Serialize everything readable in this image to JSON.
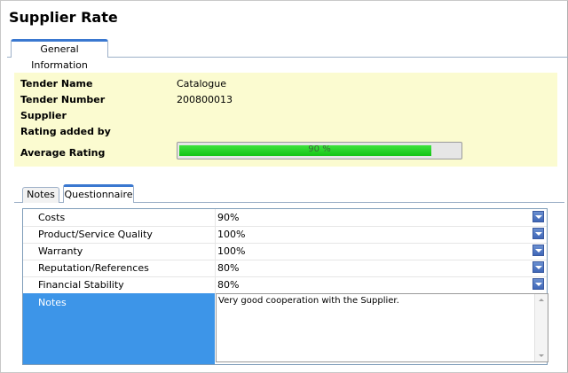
{
  "page": {
    "title": "Supplier Rate"
  },
  "top_tabs": [
    {
      "label": "General Information",
      "active": true
    }
  ],
  "general": {
    "fields": [
      {
        "label": "Tender Name",
        "value": "Catalogue"
      },
      {
        "label": "Tender Number",
        "value": "200800013"
      },
      {
        "label": "Supplier",
        "value": ""
      },
      {
        "label": "Rating added by",
        "value": ""
      }
    ],
    "average_rating": {
      "label": "Average Rating",
      "text": "90 %",
      "percent": 90
    }
  },
  "sub_tabs": [
    {
      "label": "Notes",
      "active": false
    },
    {
      "label": "Questionnaire",
      "active": true
    }
  ],
  "questionnaire": {
    "rows": [
      {
        "label": "Costs",
        "value": "90%"
      },
      {
        "label": "Product/Service Quality",
        "value": "100%"
      },
      {
        "label": "Warranty",
        "value": "100%"
      },
      {
        "label": "Reputation/References",
        "value": "80%"
      },
      {
        "label": "Financial Stability",
        "value": "80%"
      }
    ],
    "notes": {
      "label": "Notes",
      "value": "Very good cooperation with the Supplier."
    }
  },
  "colors": {
    "info_background": "#fbfbd0",
    "progress_fill": "#14c414",
    "selected_row": "#3d95e8",
    "tab_accent": "#3a78d0"
  }
}
